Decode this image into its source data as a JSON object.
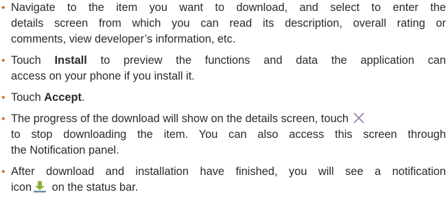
{
  "icons": {
    "bullet": "bullet-dot",
    "stop_download": "close-x-icon",
    "download_notification": "download-arrow-icon"
  },
  "colors": {
    "text": "#2a2a2a",
    "bullet": "#e0731f",
    "close_icon": "#9b7fb0",
    "download_icon_arrow": "#8db03a",
    "download_icon_bar": "#6a8a9c"
  },
  "bullets": {
    "b1": {
      "line1": "Navigate to the item you want to download, and select to enter the",
      "line2": "details screen from which you can read its description, overall rating or",
      "line3": "comments, view developer’s information, etc."
    },
    "b2": {
      "prefix": "Touch ",
      "bold": "Install",
      "suffix": " to preview the functions and data the application can",
      "line2": "access on your phone if you install it."
    },
    "b3": {
      "prefix": "Touch ",
      "bold": "Accept",
      "suffix": "."
    },
    "b4": {
      "line1": "The progress of the download will show on the details screen, touch",
      "line2": "to stop downloading the item. You can also access this screen through",
      "line3": "the Notification panel."
    },
    "b5": {
      "line1": "After download and installation have finished, you will see a notification",
      "line2_prefix": "icon",
      "line2_suffix": " on the status bar."
    }
  }
}
